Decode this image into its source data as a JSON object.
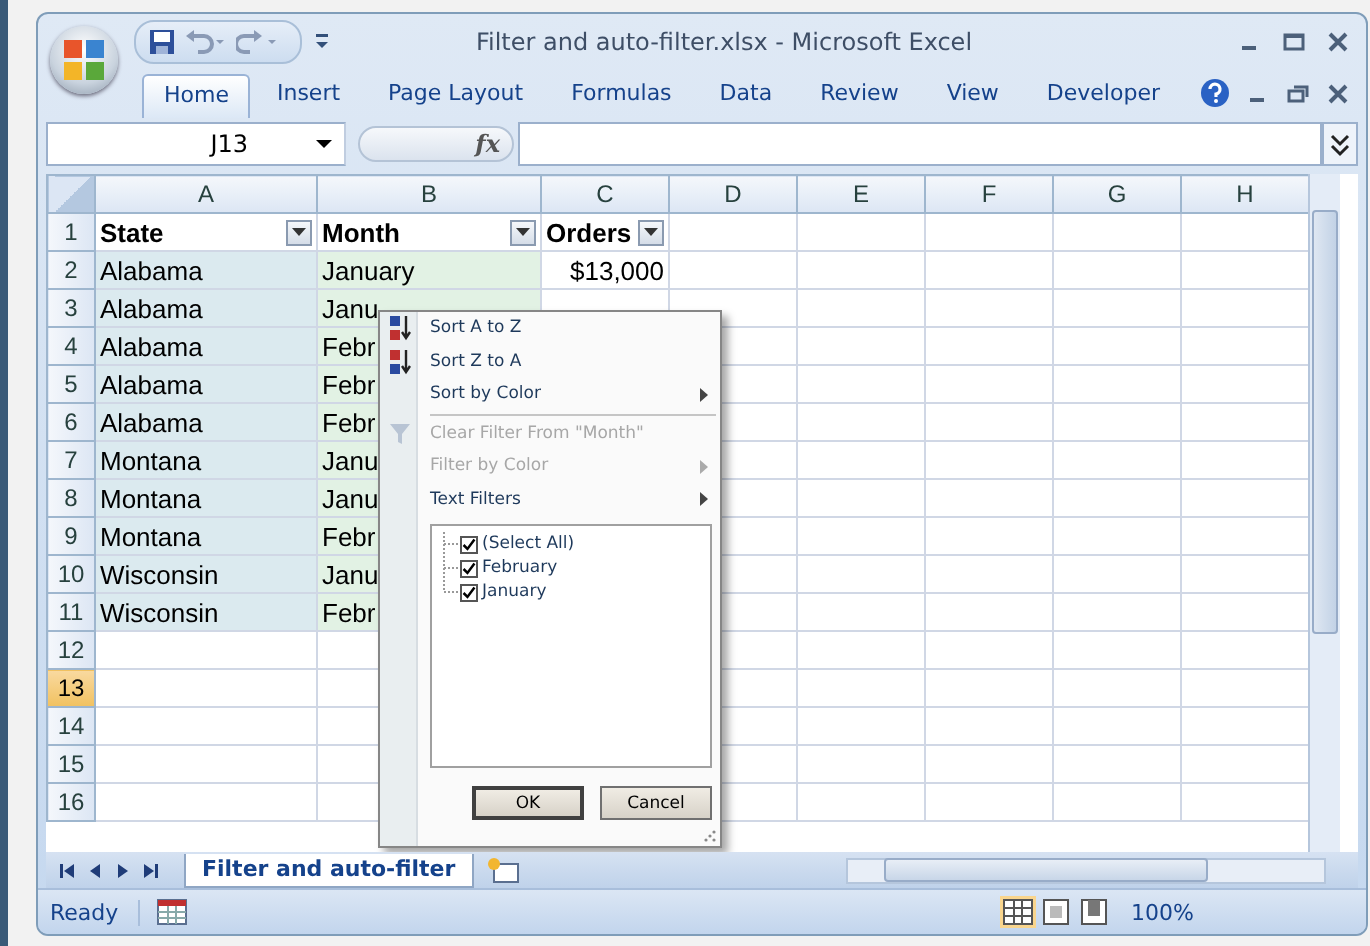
{
  "window": {
    "title": "Filter and auto-filter.xlsx - Microsoft Excel"
  },
  "ribbon_tabs": [
    {
      "label": "Home",
      "selected": true
    },
    {
      "label": "Insert",
      "selected": false
    },
    {
      "label": "Page Layout",
      "selected": false
    },
    {
      "label": "Formulas",
      "selected": false
    },
    {
      "label": "Data",
      "selected": false
    },
    {
      "label": "Review",
      "selected": false
    },
    {
      "label": "View",
      "selected": false
    },
    {
      "label": "Developer",
      "selected": false
    }
  ],
  "formula_bar": {
    "name_box": "J13",
    "fx_label": "fx"
  },
  "sheet": {
    "columns": [
      "A",
      "B",
      "C",
      "D",
      "E",
      "F",
      "G",
      "H"
    ],
    "rows": [
      {
        "number": "1",
        "selected": false,
        "cells": [
          "State",
          "Month",
          "Orders"
        ]
      },
      {
        "number": "2",
        "selected": false,
        "cells": [
          "Alabama",
          "January",
          "$13,000"
        ]
      },
      {
        "number": "3",
        "selected": false,
        "cells": [
          "Alabama",
          "Janu",
          ""
        ]
      },
      {
        "number": "4",
        "selected": false,
        "cells": [
          "Alabama",
          "Febr",
          ""
        ]
      },
      {
        "number": "5",
        "selected": false,
        "cells": [
          "Alabama",
          "Febr",
          ""
        ]
      },
      {
        "number": "6",
        "selected": false,
        "cells": [
          "Alabama",
          "Febr",
          ""
        ]
      },
      {
        "number": "7",
        "selected": false,
        "cells": [
          "Montana",
          "Janu",
          ""
        ]
      },
      {
        "number": "8",
        "selected": false,
        "cells": [
          "Montana",
          "Janu",
          ""
        ]
      },
      {
        "number": "9",
        "selected": false,
        "cells": [
          "Montana",
          "Febr",
          ""
        ]
      },
      {
        "number": "10",
        "selected": false,
        "cells": [
          "Wisconsin",
          "Janu",
          ""
        ]
      },
      {
        "number": "11",
        "selected": false,
        "cells": [
          "Wisconsin",
          "Febr",
          ""
        ]
      },
      {
        "number": "12",
        "selected": false,
        "cells": []
      },
      {
        "number": "13",
        "selected": true,
        "cells": []
      },
      {
        "number": "14",
        "selected": false,
        "cells": []
      },
      {
        "number": "15",
        "selected": false,
        "cells": []
      },
      {
        "number": "16",
        "selected": false,
        "cells": []
      }
    ]
  },
  "filter_menu": {
    "items": [
      {
        "kind": "sort",
        "label": "Sort A to Z",
        "disabled": false,
        "submenu": false
      },
      {
        "kind": "sort-desc",
        "label": "Sort Z to A",
        "disabled": false,
        "submenu": false
      },
      {
        "kind": "plain",
        "label": "Sort by Color",
        "disabled": false,
        "submenu": true
      },
      {
        "kind": "separator"
      },
      {
        "kind": "clear",
        "label": "Clear Filter From \"Month\"",
        "disabled": true,
        "submenu": false
      },
      {
        "kind": "plain",
        "label": "Filter by Color",
        "disabled": true,
        "submenu": true
      },
      {
        "kind": "plain",
        "label": "Text Filters",
        "disabled": false,
        "submenu": true
      }
    ],
    "values": [
      {
        "label": "(Select All)",
        "checked": true
      },
      {
        "label": "February",
        "checked": true
      },
      {
        "label": "January",
        "checked": true
      }
    ],
    "buttons": [
      "OK",
      "Cancel"
    ]
  },
  "sheet_tabs": [
    {
      "label": "Filter and auto-filter",
      "selected": true
    }
  ],
  "status_bar": {
    "mode": "Ready",
    "zoom": "100%"
  }
}
